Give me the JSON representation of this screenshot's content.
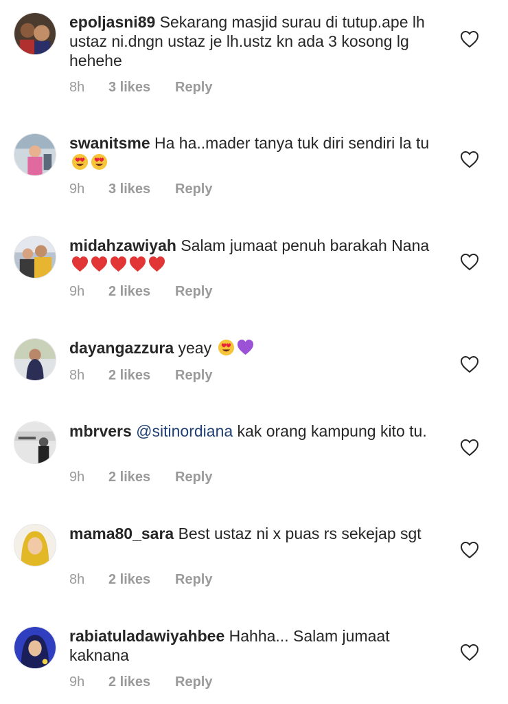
{
  "comments": [
    {
      "username": "epoljasni89",
      "text": "Sekarang masjid surau di tutup.ape lh ustaz ni.dngn ustaz je lh.ustz kn ada 3 kosong lg hehehe",
      "time": "8h",
      "likes": "3 likes",
      "reply": "Reply",
      "icon": "heart-outline-icon"
    },
    {
      "username": "swanitsme",
      "text": "Ha ha..mader tanya tuk diri sendiri la tu",
      "emojis": [
        "heart-eyes-emoji",
        "heart-eyes-emoji"
      ],
      "time": "9h",
      "likes": "3 likes",
      "reply": "Reply",
      "icon": "heart-outline-icon"
    },
    {
      "username": "midahzawiyah",
      "text": "Salam jumaat penuh barakah Nana",
      "emojis": [
        "red-heart-emoji",
        "red-heart-emoji",
        "red-heart-emoji",
        "red-heart-emoji",
        "red-heart-emoji"
      ],
      "time": "9h",
      "likes": "2 likes",
      "reply": "Reply",
      "icon": "heart-outline-icon"
    },
    {
      "username": "dayangazzura",
      "text": "yeay",
      "emojis": [
        "heart-eyes-emoji",
        "purple-heart-emoji"
      ],
      "time": "8h",
      "likes": "2 likes",
      "reply": "Reply",
      "icon": "heart-outline-icon"
    },
    {
      "username": "mbrvers",
      "mention": "@sitinordiana",
      "text": "kak orang kampung kito tu.",
      "time": "9h",
      "likes": "2 likes",
      "reply": "Reply",
      "icon": "heart-outline-icon"
    },
    {
      "username": "mama80_sara",
      "text": "Best ustaz ni  x puas rs sekejap sgt",
      "time": "8h",
      "likes": "2 likes",
      "reply": "Reply",
      "icon": "heart-outline-icon"
    },
    {
      "username": "rabiatuladawiyahbee",
      "text": "Hahha... Salam jumaat kaknana",
      "time": "9h",
      "likes": "2 likes",
      "reply": "Reply",
      "icon": "heart-outline-icon"
    }
  ],
  "colors": {
    "text": "#262626",
    "meta": "#9a9a9a",
    "mention": "#1f3f74",
    "background": "#ffffff"
  }
}
